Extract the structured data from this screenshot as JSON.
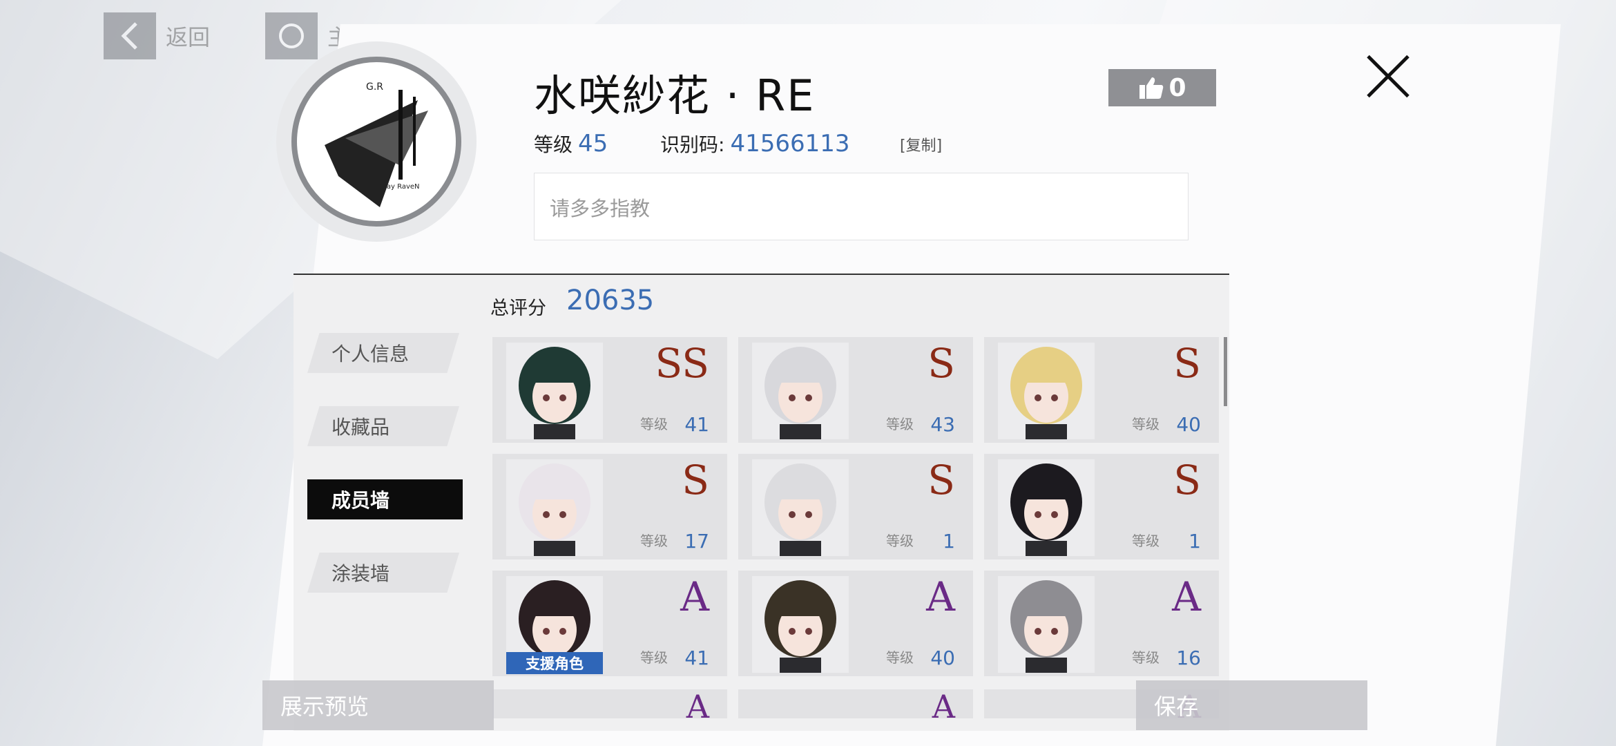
{
  "nav": {
    "back_label": "返回",
    "home_label": "主界面"
  },
  "profile": {
    "name": "水咲紗花 · RE",
    "level_label": "等级",
    "level": "45",
    "id_label": "识别码:",
    "id": "41566113",
    "copy_label": "[复制]",
    "likes": "0",
    "bio": "请多多指教",
    "avatar_text": {
      "top": "G.R",
      "bottom": "Gray RaveN"
    }
  },
  "score": {
    "label": "总评分",
    "value": "20635"
  },
  "tabs": [
    {
      "label": "个人信息",
      "active": false
    },
    {
      "label": "收藏品",
      "active": false
    },
    {
      "label": "成员墙",
      "active": true
    },
    {
      "label": "涂装墙",
      "active": false
    }
  ],
  "members": [
    {
      "rank": "SS",
      "level_label": "等级",
      "level": "41",
      "hair": "#1f3a34",
      "support": ""
    },
    {
      "rank": "S",
      "level_label": "等级",
      "level": "43",
      "hair": "#d8d8dc",
      "support": ""
    },
    {
      "rank": "S",
      "level_label": "等级",
      "level": "40",
      "hair": "#e6cf84",
      "support": ""
    },
    {
      "rank": "S",
      "level_label": "等级",
      "level": "17",
      "hair": "#e9e4ea",
      "support": ""
    },
    {
      "rank": "S",
      "level_label": "等级",
      "level": "1",
      "hair": "#dcdcdf",
      "support": ""
    },
    {
      "rank": "S",
      "level_label": "等级",
      "level": "1",
      "hair": "#1c1a1f",
      "support": ""
    },
    {
      "rank": "A",
      "level_label": "等级",
      "level": "41",
      "hair": "#2a1f22",
      "support": "支援角色"
    },
    {
      "rank": "A",
      "level_label": "等级",
      "level": "40",
      "hair": "#3a3226",
      "support": ""
    },
    {
      "rank": "A",
      "level_label": "等级",
      "level": "16",
      "hair": "#8e8d92",
      "support": ""
    }
  ],
  "partial_row_ranks": [
    "A",
    "A",
    "A"
  ],
  "bottom": {
    "preview_label": "展示预览",
    "save_label": "保存"
  },
  "colors": {
    "accent_blue": "#3b6db3",
    "rank_s": "#8a2a16",
    "rank_a": "#6a2a86"
  },
  "icons": {
    "back": "chevron-left-icon",
    "home": "circle-icon",
    "like": "thumbs-up-icon",
    "close": "close-icon"
  }
}
